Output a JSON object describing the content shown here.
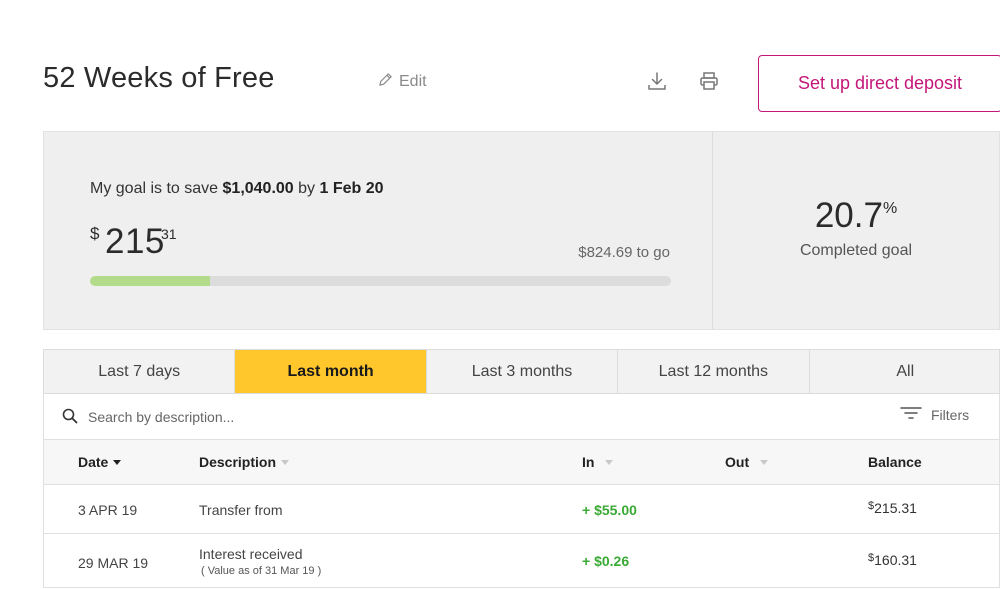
{
  "page": {
    "title": "52 Weeks of Free",
    "edit_label": "Edit",
    "download_icon": "download-icon",
    "print_icon": "print-icon",
    "deposit_button": "Set up direct deposit"
  },
  "goal": {
    "text_prefix": "My goal is to save",
    "target_amount": "$1,040.00",
    "text_by": "by",
    "target_date": "1 Feb 20",
    "currency_symbol": "$",
    "saved_whole": "215",
    "saved_cents": "31",
    "remaining": "$824.69 to go",
    "progress_fraction": 0.207,
    "progress_color": "#b3dc8a",
    "percent_value": "20.7",
    "percent_sign": "%",
    "percent_label": "Completed goal"
  },
  "tabs": [
    {
      "label": "Last 7 days",
      "active": false
    },
    {
      "label": "Last month",
      "active": true
    },
    {
      "label": "Last 3 months",
      "active": false
    },
    {
      "label": "Last 12 months",
      "active": false
    },
    {
      "label": "All",
      "active": false
    }
  ],
  "search": {
    "placeholder": "Search by description...",
    "filters_label": "Filters"
  },
  "table": {
    "headers": {
      "date": "Date",
      "description": "Description",
      "in": "In",
      "out": "Out",
      "balance": "Balance"
    },
    "rows": [
      {
        "date": "3 APR 19",
        "description": "Transfer from",
        "note": "",
        "in": "+ $55.00",
        "out": "",
        "balance_symbol": "$",
        "balance": "215.31"
      },
      {
        "date": "29 MAR 19",
        "description": "Interest received",
        "note": "( Value as of 31 Mar 19 )",
        "in": "+ $0.26",
        "out": "",
        "balance_symbol": "$",
        "balance": "160.31"
      }
    ]
  },
  "colors": {
    "accent": "#c4177a",
    "active_tab": "#ffc72c",
    "positive": "#3aaa35"
  }
}
